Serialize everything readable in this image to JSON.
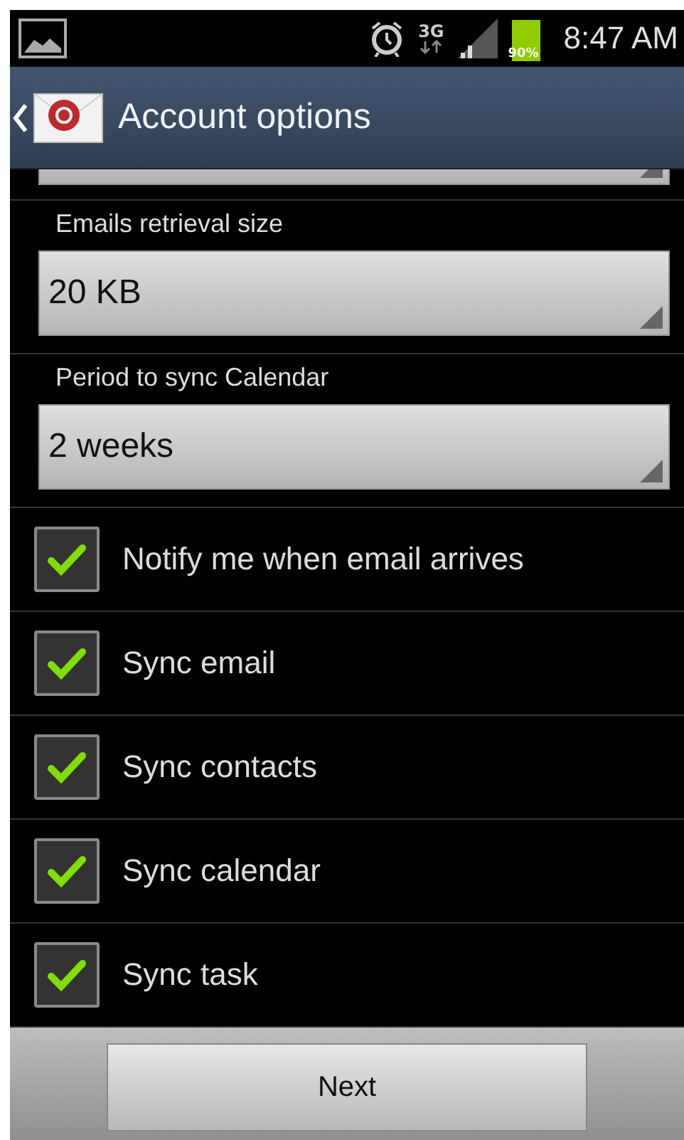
{
  "status_bar": {
    "network": "3G",
    "battery": {
      "label": "90%",
      "level": 0.9
    },
    "time": "8:47 AM"
  },
  "action_bar": {
    "title": "Account options"
  },
  "settings": [
    {
      "kind": "dropdown",
      "label": "Emails retrieval size",
      "value": "20 KB"
    },
    {
      "kind": "dropdown",
      "label": "Period to sync Calendar",
      "value": "2 weeks"
    },
    {
      "kind": "checkbox",
      "label": "Notify me when email arrives",
      "checked": true
    },
    {
      "kind": "checkbox",
      "label": "Sync email",
      "checked": true
    },
    {
      "kind": "checkbox",
      "label": "Sync contacts",
      "checked": true
    },
    {
      "kind": "checkbox",
      "label": "Sync calendar",
      "checked": true
    },
    {
      "kind": "checkbox",
      "label": "Sync task",
      "checked": true
    }
  ],
  "footer": {
    "button": "Next"
  }
}
